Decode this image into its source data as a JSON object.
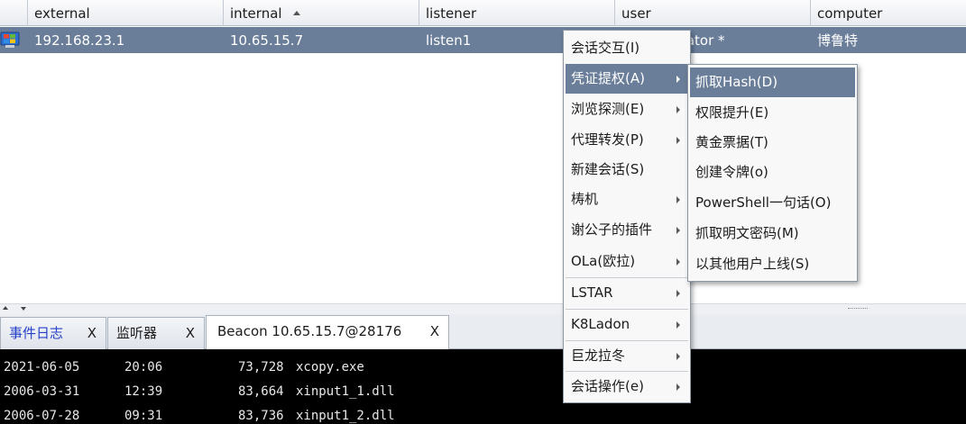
{
  "table": {
    "columns": [
      "external",
      "internal",
      "listener",
      "user",
      "computer"
    ],
    "sorted_column": "internal",
    "rows": [
      {
        "external": "192.168.23.1",
        "internal": "10.65.15.7",
        "listener": "listen1",
        "user": "Administrator *",
        "computer": "博鲁特"
      }
    ]
  },
  "context_menu": {
    "items": [
      {
        "label": "会话交互(I)",
        "has_submenu": false
      },
      {
        "label": "凭证提权(A)",
        "has_submenu": true,
        "highlighted": true
      },
      {
        "label": "浏览探测(E)",
        "has_submenu": true
      },
      {
        "label": "代理转发(P)",
        "has_submenu": true
      },
      {
        "label": "新建会话(S)",
        "has_submenu": false
      },
      {
        "label": "梼机",
        "has_submenu": true
      },
      {
        "label": "谢公子的插件",
        "has_submenu": true
      },
      {
        "label": "OLa(欧拉)",
        "has_submenu": true
      },
      {
        "label": "LSTAR",
        "has_submenu": true
      },
      {
        "label": "K8Ladon",
        "has_submenu": true
      },
      {
        "label": "巨龙拉冬",
        "has_submenu": true
      },
      {
        "label": "会话操作(e)",
        "has_submenu": true
      }
    ]
  },
  "submenu": {
    "items": [
      {
        "label": "抓取Hash(D)",
        "highlighted": true
      },
      {
        "label": "权限提升(E)"
      },
      {
        "label": "黄金票据(T)"
      },
      {
        "label": "创建令牌(o)"
      },
      {
        "label": "PowerShell一句话(O)"
      },
      {
        "label": "抓取明文密码(M)"
      },
      {
        "label": "以其他用户上线(S)"
      }
    ]
  },
  "tabs": [
    {
      "label": "事件日志",
      "close": "X",
      "active": false
    },
    {
      "label": "监听器",
      "close": "X",
      "active": false
    },
    {
      "label": "Beacon 10.65.15.7@28176",
      "close": "X",
      "active": true
    }
  ],
  "console": {
    "lines": [
      {
        "date": "2021-06-05",
        "time": "20:06",
        "size": "73,728",
        "name": "xcopy.exe"
      },
      {
        "date": "2006-03-31",
        "time": "12:39",
        "size": "83,664",
        "name": "xinput1_1.dll"
      },
      {
        "date": "2006-07-28",
        "time": "09:31",
        "size": "83,736",
        "name": "xinput1_2.dll"
      }
    ]
  },
  "colors": {
    "selection": "#6a7e99",
    "console_bg": "#000000",
    "event_tab_text": "#2440c8"
  },
  "icons": {
    "row_icon": "windows-computer-icon",
    "sort_icon": "sort-ascending-icon"
  }
}
